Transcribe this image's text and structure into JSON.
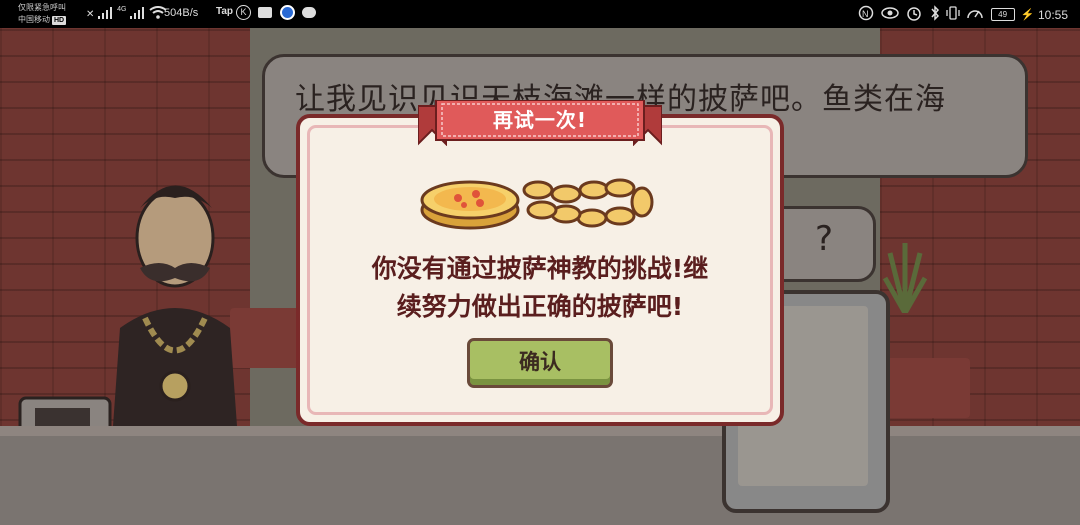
{
  "statusbar": {
    "carrier_line1": "仅限紧急呼叫",
    "carrier_line2": "中国移动",
    "carrier_badge": "HD",
    "network_type": "4G",
    "speed": "504B/s",
    "tap_label": "Tap",
    "k_badge": "K",
    "battery": "49",
    "clock": "10:55"
  },
  "scene": {
    "speech_text": "让我见识见识天枝海滩一样的披萨吧。鱼类在海中……鲍。",
    "speech2_text": "?"
  },
  "modal": {
    "title": "再试一次!",
    "message_line1": "你没有通过披萨神教的挑战!继",
    "message_line2": "续努力做出正确的披萨吧!",
    "confirm_label": "确认"
  },
  "colors": {
    "modal_bg": "#f7f0e6",
    "modal_border": "#7a2a2a",
    "ribbon_red": "#e05a5a",
    "confirm_green": "#a8bf63",
    "text_dark_red": "#5a1e1e"
  },
  "icons": [
    "signal-icon",
    "wifi-icon",
    "tap-icon",
    "k-icon",
    "mail-icon",
    "browser-icon",
    "wechat-icon",
    "nfc-icon",
    "eye-icon",
    "alarm-icon",
    "bluetooth-icon",
    "gauge-icon",
    "battery-icon",
    "charging-icon",
    "coin-chain-icon"
  ]
}
